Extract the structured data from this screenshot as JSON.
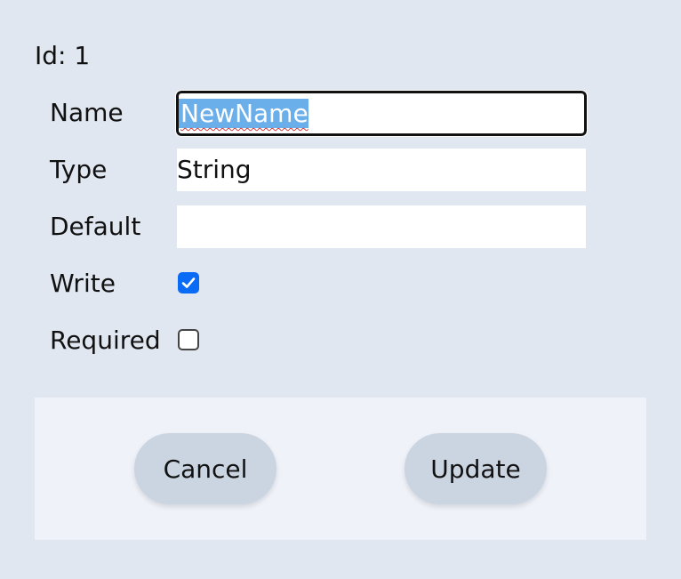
{
  "id_line": "Id: 1",
  "fields": {
    "name": {
      "label": "Name",
      "value": "NewName"
    },
    "type": {
      "label": "Type",
      "value": "String"
    },
    "default": {
      "label": "Default",
      "value": ""
    },
    "write": {
      "label": "Write",
      "checked": true
    },
    "required": {
      "label": "Required",
      "checked": false
    }
  },
  "buttons": {
    "cancel": "Cancel",
    "update": "Update"
  },
  "colors": {
    "dialog_bg": "#e1e7f0",
    "footer_bg": "#eff3f9",
    "button_bg": "#cbd5e1",
    "checkbox_accent": "#0a6cf6",
    "selection": "#6aaeea"
  }
}
